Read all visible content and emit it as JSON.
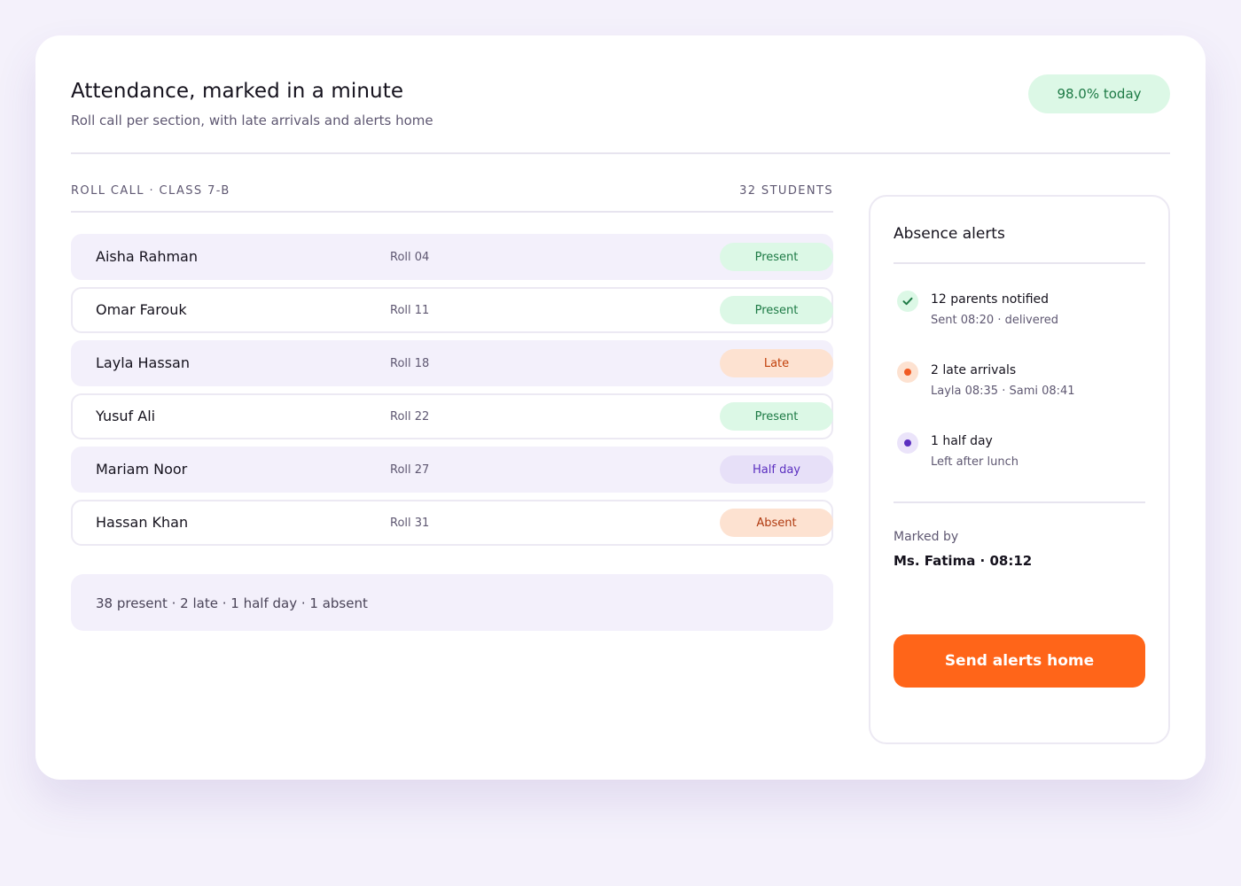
{
  "header": {
    "title": "Attendance, marked in a minute",
    "subtitle": "Roll call per section, with late arrivals and alerts home",
    "today_badge": "98.0% today"
  },
  "roll_call": {
    "label": "ROLL CALL · CLASS 7-B",
    "count": "32 STUDENTS",
    "students": [
      {
        "name": "Aisha Rahman",
        "roll": "Roll 04",
        "status": "Present"
      },
      {
        "name": "Omar Farouk",
        "roll": "Roll 11",
        "status": "Present"
      },
      {
        "name": "Layla Hassan",
        "roll": "Roll 18",
        "status": "Late"
      },
      {
        "name": "Yusuf Ali",
        "roll": "Roll 22",
        "status": "Present"
      },
      {
        "name": "Mariam Noor",
        "roll": "Roll 27",
        "status": "Half day"
      },
      {
        "name": "Hassan Khan",
        "roll": "Roll 31",
        "status": "Absent"
      }
    ],
    "summary": "38 present · 2 late · 1 half day · 1 absent"
  },
  "alerts_panel": {
    "title": "Absence alerts",
    "alerts": [
      {
        "icon": "check-icon",
        "title": "12 parents notified",
        "detail": "Sent 08:20 · delivered"
      },
      {
        "icon": "orange-dot-icon",
        "title": "2 late arrivals",
        "detail": "Layla 08:35 · Sami 08:41"
      },
      {
        "icon": "purple-dot-icon",
        "title": "1 half day",
        "detail": "Left after lunch"
      }
    ],
    "marked_by_label": "Marked by",
    "marked_by_value": "Ms. Fatima · 08:12",
    "send_button": "Send alerts home"
  },
  "colors": {
    "accent": "#ff6519",
    "present": "#1d7a45",
    "late": "#c2410c",
    "half_day": "#5b2fc0",
    "background": "#f4f1fb"
  }
}
